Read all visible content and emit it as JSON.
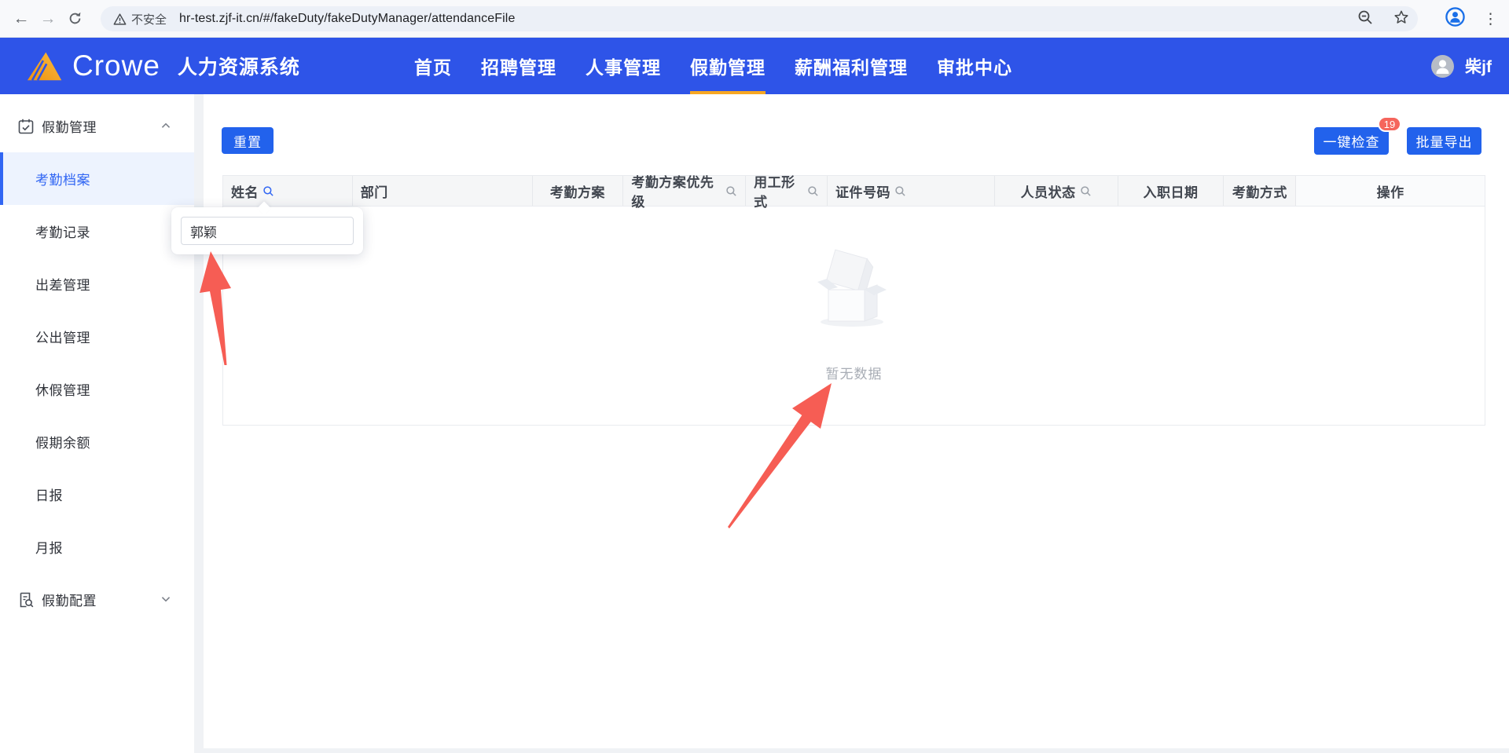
{
  "browser": {
    "back_icon": "back-arrow-icon",
    "forward_icon": "forward-arrow-icon",
    "reload_icon": "reload-icon",
    "security_label": "不安全",
    "url": "hr-test.zjf-it.cn/#/fakeDuty/fakeDutyManager/attendanceFile",
    "zoom_icon": "zoom-out-icon",
    "bookmark_icon": "bookmark-star-icon",
    "profile_icon": "profile-icon",
    "menu_icon": "kebab-menu-icon"
  },
  "header": {
    "logo_text": "Crowe",
    "app_title": "人力资源系统",
    "nav": [
      {
        "label": "首页",
        "active": false
      },
      {
        "label": "招聘管理",
        "active": false
      },
      {
        "label": "人事管理",
        "active": false
      },
      {
        "label": "假勤管理",
        "active": true
      },
      {
        "label": "薪酬福利管理",
        "active": false
      },
      {
        "label": "审批中心",
        "active": false
      }
    ],
    "user_name": "柴jf",
    "accent_underline_color": "#f7a723",
    "header_color": "#2e54e8"
  },
  "sidebar": {
    "groups": [
      {
        "label": "假勤管理",
        "icon": "calendar-check-icon",
        "chevron": "chevron-up-icon",
        "expanded": true,
        "items": [
          {
            "label": "考勤档案",
            "active": true
          },
          {
            "label": "考勤记录",
            "active": false
          },
          {
            "label": "出差管理",
            "active": false
          },
          {
            "label": "公出管理",
            "active": false
          },
          {
            "label": "休假管理",
            "active": false
          },
          {
            "label": "假期余额",
            "active": false
          },
          {
            "label": "日报",
            "active": false
          },
          {
            "label": "月报",
            "active": false
          }
        ]
      },
      {
        "label": "假勤配置",
        "icon": "document-search-icon",
        "chevron": "chevron-down-icon",
        "expanded": false,
        "items": []
      }
    ],
    "active_color": "#3166f3"
  },
  "toolbar": {
    "reset_label": "重置",
    "check_label": "一键检查",
    "check_badge_count": "19",
    "export_label": "批量导出",
    "button_color": "#2262ec",
    "badge_color": "#f5655c"
  },
  "table": {
    "columns": [
      {
        "label": "姓名",
        "search_icon": true,
        "search_active": true
      },
      {
        "label": "部门",
        "search_icon": false,
        "search_active": false
      },
      {
        "label": "考勤方案",
        "search_icon": false,
        "search_active": false
      },
      {
        "label": "考勤方案优先级",
        "search_icon": true,
        "search_active": false
      },
      {
        "label": "用工形式",
        "search_icon": true,
        "search_active": false
      },
      {
        "label": "证件号码",
        "search_icon": true,
        "search_active": false
      },
      {
        "label": "人员状态",
        "search_icon": true,
        "search_active": false
      },
      {
        "label": "入职日期",
        "search_icon": false,
        "search_active": false
      },
      {
        "label": "考勤方式",
        "search_icon": false,
        "search_active": false
      },
      {
        "label": "操作",
        "search_icon": false,
        "search_active": false
      }
    ],
    "empty_text": "暂无数据",
    "empty_icon": "empty-box-icon"
  },
  "filter_popup": {
    "input_value": "郭颖"
  },
  "annotations": {
    "arrow_color": "#f65d54",
    "arrows": [
      "arrow-to-name-filter-input",
      "arrow-to-empty-text"
    ]
  }
}
